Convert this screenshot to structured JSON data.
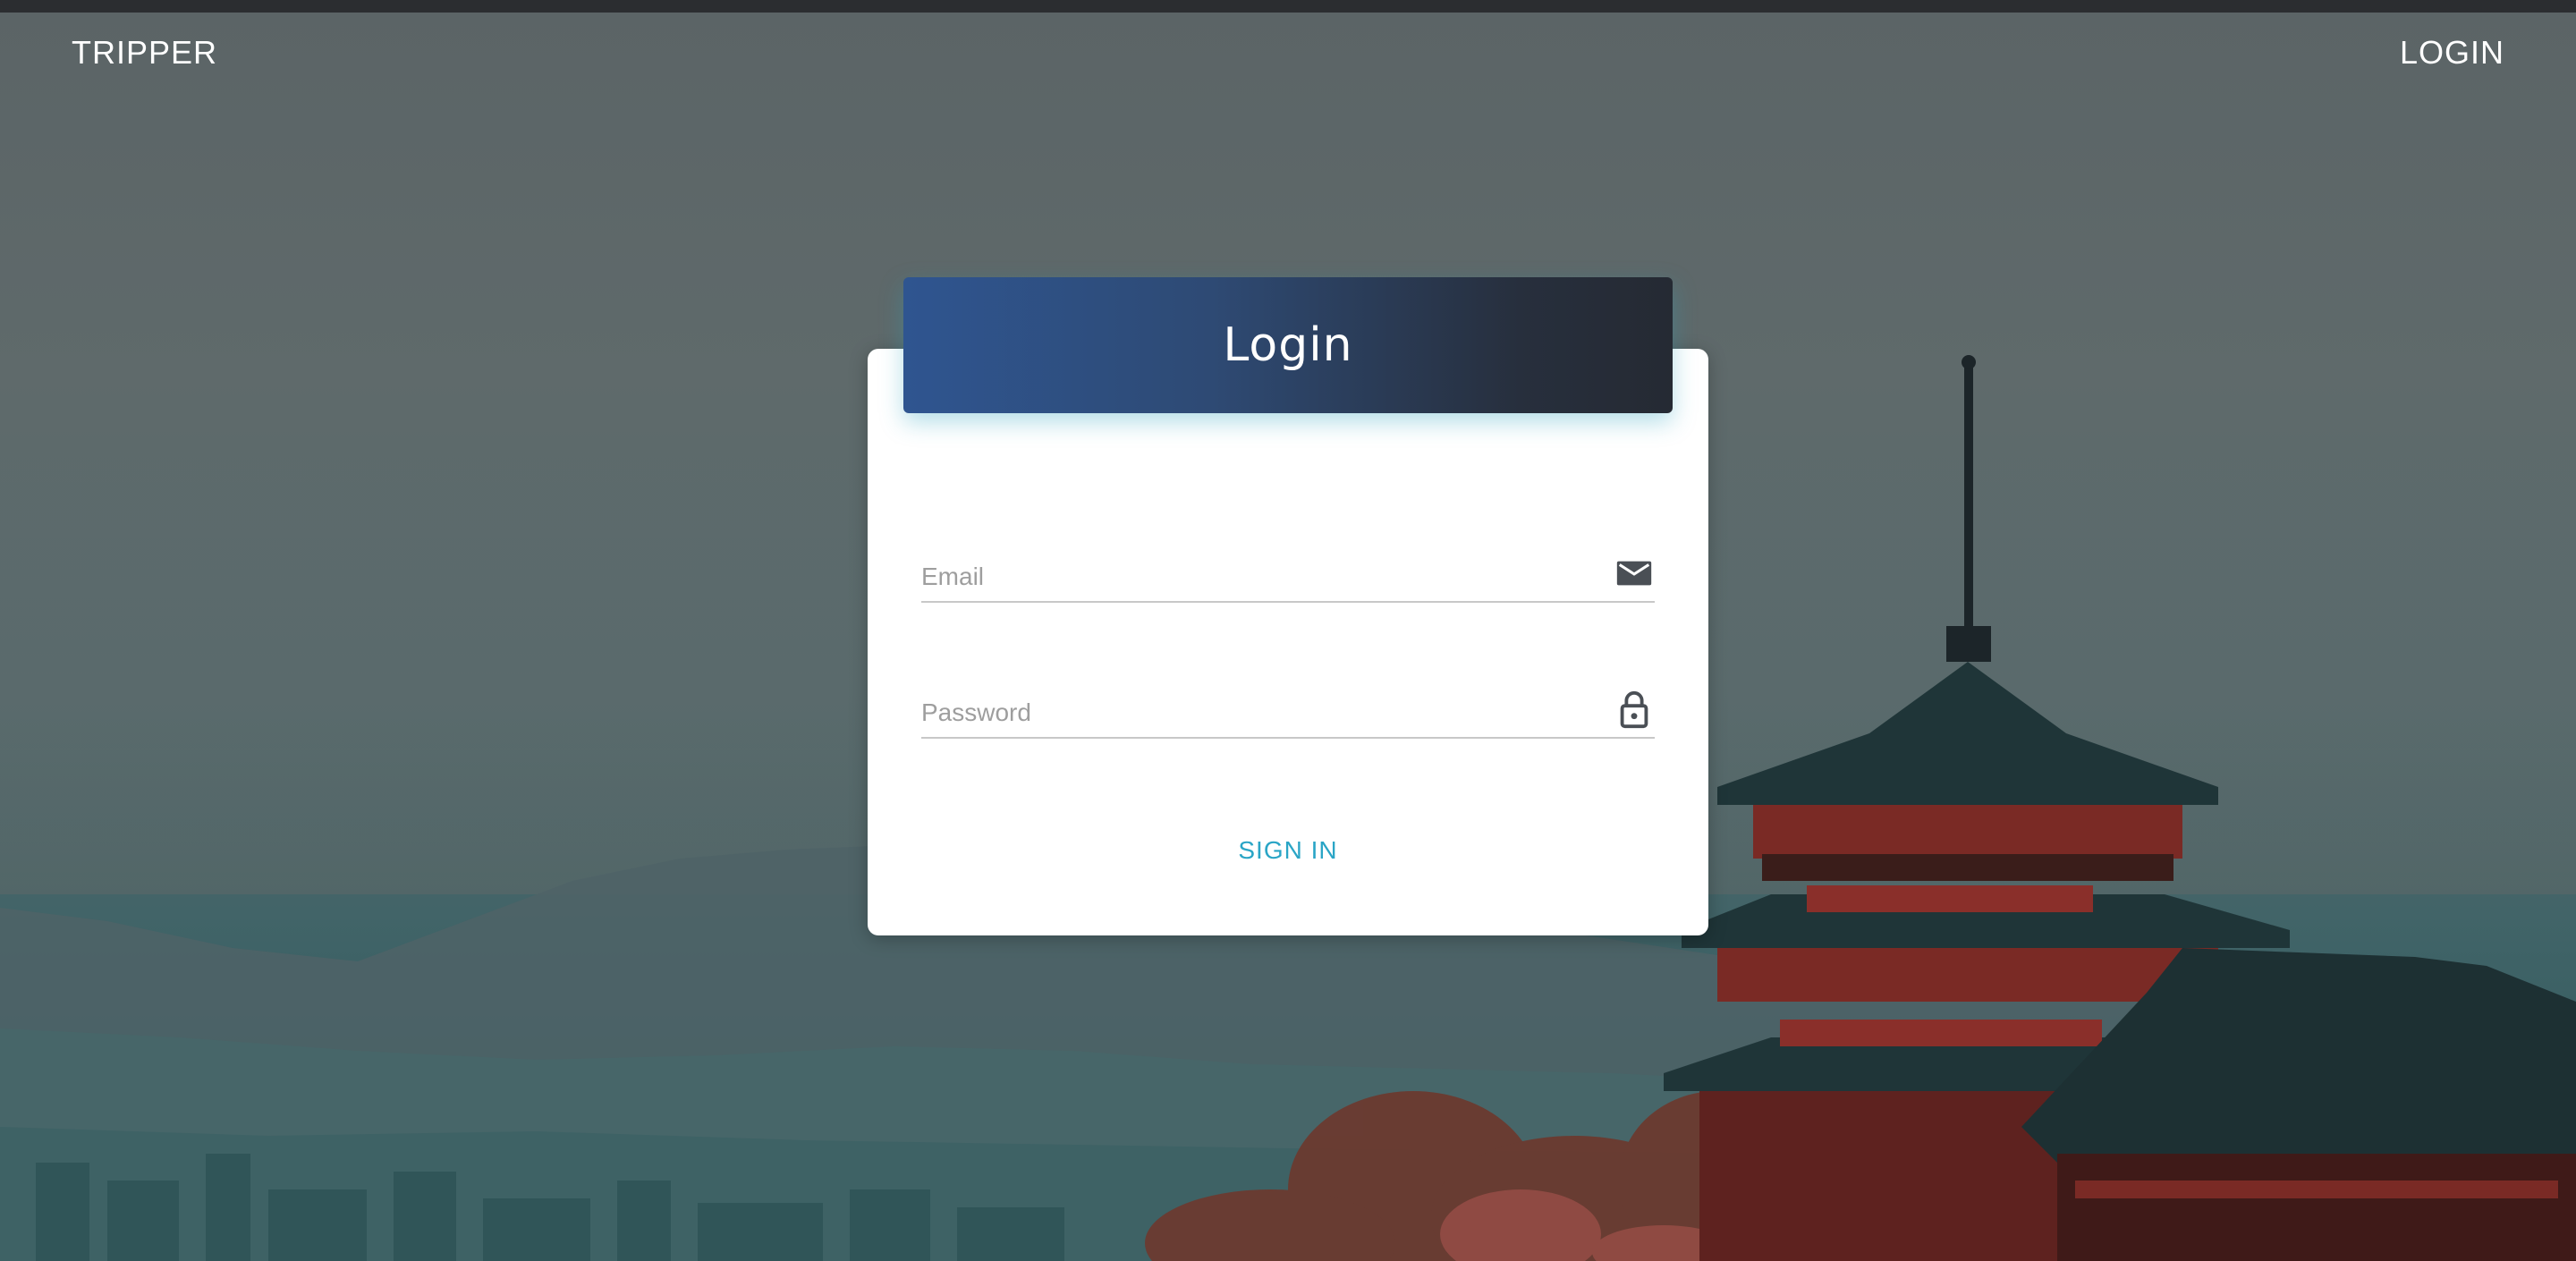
{
  "navbar": {
    "brand": "TRIPPER",
    "login_link": "LOGIN"
  },
  "login_card": {
    "title": "Login",
    "email": {
      "placeholder": "Email",
      "value": "",
      "icon": "mail-icon"
    },
    "password": {
      "placeholder": "Password",
      "value": "",
      "icon": "lock-icon"
    },
    "submit_label": "SIGN IN"
  },
  "colors": {
    "header_gradient_start": "#2f5590",
    "header_gradient_end": "#252a33",
    "accent": "#2aa5c6",
    "card_bg": "#ffffff"
  }
}
